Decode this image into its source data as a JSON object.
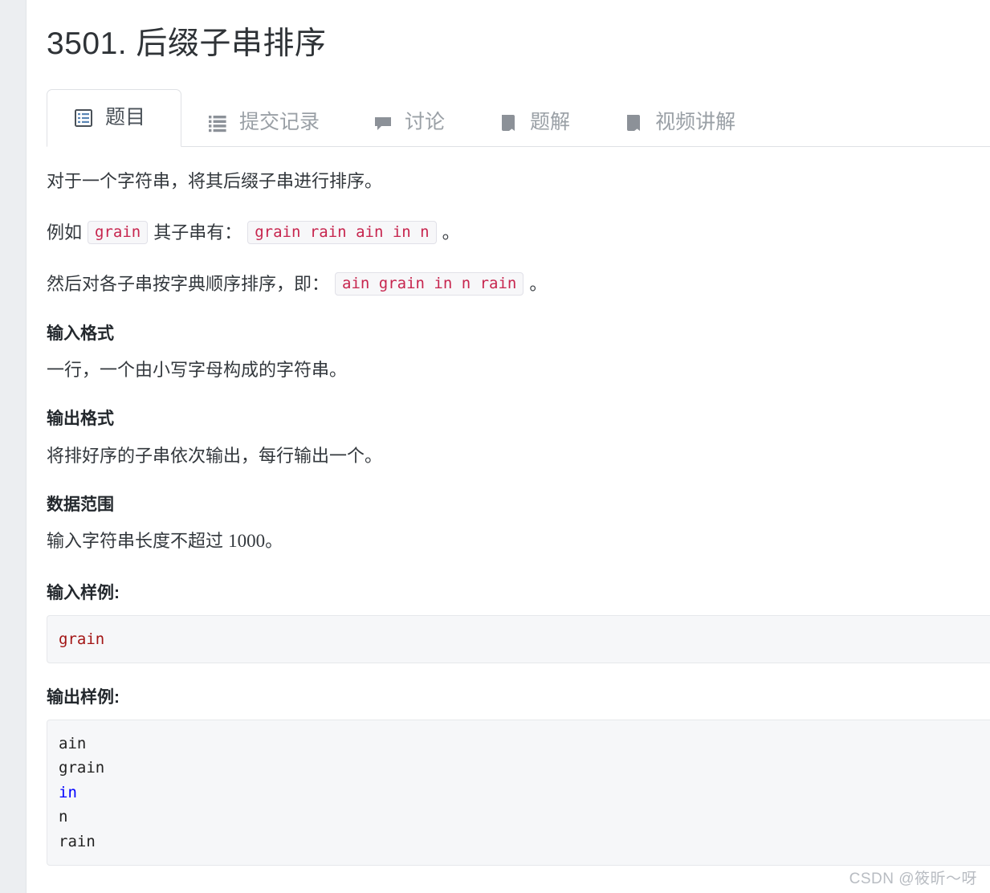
{
  "page": {
    "title": "3501. 后缀子串排序"
  },
  "tabs": [
    {
      "label": "题目",
      "icon": "document-list-icon",
      "active": true
    },
    {
      "label": "提交记录",
      "icon": "list-icon",
      "active": false
    },
    {
      "label": "讨论",
      "icon": "comment-icon",
      "active": false
    },
    {
      "label": "题解",
      "icon": "book-icon",
      "active": false
    },
    {
      "label": "视频讲解",
      "icon": "book-icon",
      "active": false
    }
  ],
  "content": {
    "intro": "对于一个字符串，将其后缀子串进行排序。",
    "example_prefix": "例如",
    "example_code": "grain",
    "example_middle": "其子串有：",
    "example_list_code": "grain rain ain in n",
    "example_suffix": "。",
    "sorted_prefix": "然后对各子串按字典顺序排序，即：",
    "sorted_code": "ain grain in n rain",
    "sorted_suffix": "。",
    "sections": [
      {
        "heading": "输入格式",
        "body_prefix": "一行，一个由小写字母构成的字符串。",
        "body_num": "",
        "body_suffix": ""
      },
      {
        "heading": "输出格式",
        "body_prefix": "将排好序的子串依次输出，每行输出一个。",
        "body_num": "",
        "body_suffix": ""
      },
      {
        "heading": "数据范围",
        "body_prefix": "输入字符串长度不超过 ",
        "body_num": "1000",
        "body_suffix": "。"
      }
    ],
    "input_sample": {
      "label": "输入样例:",
      "lines": [
        {
          "text": "grain",
          "style": "str"
        }
      ]
    },
    "output_sample": {
      "label": "输出样例:",
      "lines": [
        {
          "text": "ain",
          "style": "plain"
        },
        {
          "text": "grain",
          "style": "plain"
        },
        {
          "text": "in",
          "style": "kw"
        },
        {
          "text": "n",
          "style": "plain"
        },
        {
          "text": "rain",
          "style": "plain"
        }
      ]
    }
  },
  "watermark": "CSDN @筱昕～呀",
  "colors": {
    "inline_code_text": "#c7254e",
    "inline_code_bg": "#f7f7f9",
    "code_block_bg": "#f6f7f9",
    "string_red": "#a31515",
    "keyword_blue": "#0000ff",
    "tab_inactive": "#9aa0a6",
    "tab_active": "#4a5158"
  }
}
